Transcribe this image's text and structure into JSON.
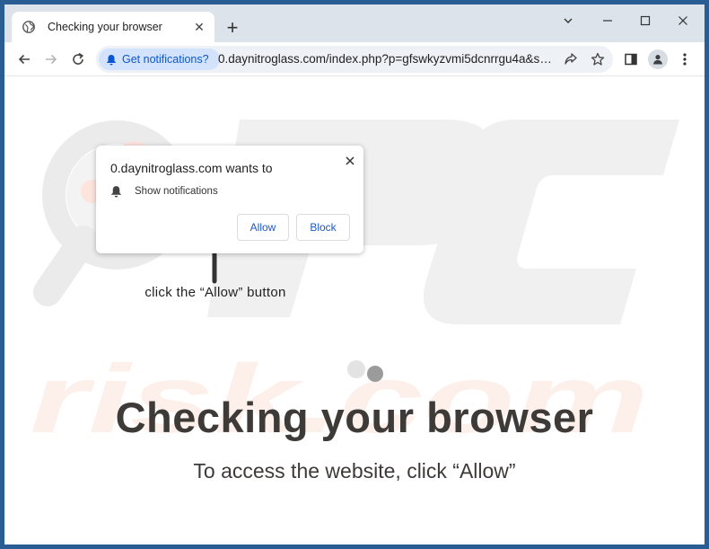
{
  "tab": {
    "title": "Checking your browser",
    "globe_icon": "globe-icon",
    "close_glyph": "✕"
  },
  "newtab_glyph": "+",
  "toolbar": {
    "permission_chip": "Get notifications?",
    "url": "0.daynitroglass.com/index.php?p=gfswkyzvmi5dcnrrgu4a&sub..."
  },
  "popup": {
    "title": "0.daynitroglass.com wants to",
    "permission": "Show notifications",
    "allow_label": "Allow",
    "block_label": "Block"
  },
  "page": {
    "arrow_label": "click the “Allow” button",
    "headline": "Checking your browser",
    "subline": "To access the website, click “Allow”"
  },
  "colors": {
    "frame": "#2a5d93",
    "tabstrip": "#dde3ea",
    "chip_bg": "#d3e3fd",
    "chip_text": "#0b57d0",
    "headline": "#3d3a38"
  }
}
